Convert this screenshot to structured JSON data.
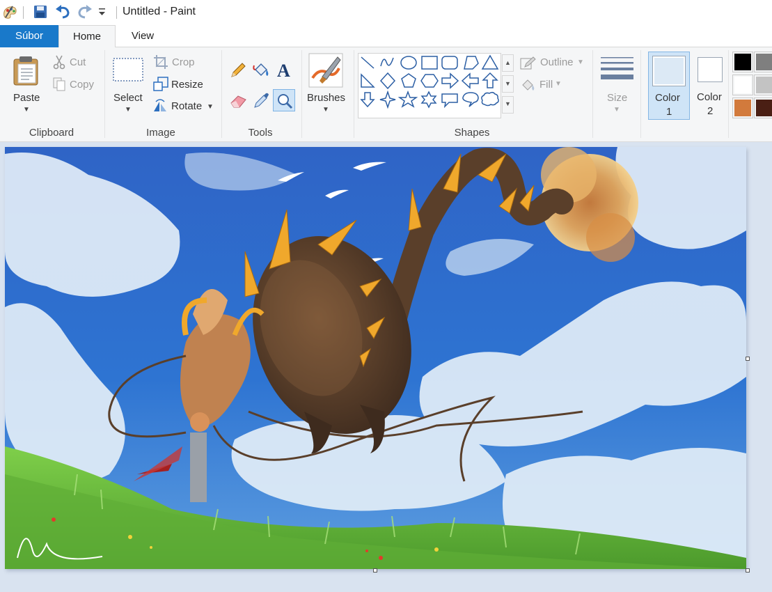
{
  "window": {
    "title": "Untitled - Paint"
  },
  "quick_access": {
    "icons": [
      "paint-app-icon",
      "save-icon",
      "undo-icon",
      "redo-icon",
      "customize-toolbar-icon"
    ]
  },
  "tabs": {
    "file": "Súbor",
    "home": "Home",
    "view": "View"
  },
  "ribbon": {
    "clipboard": {
      "label": "Clipboard",
      "paste": "Paste",
      "cut": "Cut",
      "copy": "Copy"
    },
    "image": {
      "label": "Image",
      "select": "Select",
      "crop": "Crop",
      "resize": "Resize",
      "rotate": "Rotate"
    },
    "tools": {
      "label": "Tools",
      "icons": [
        "pencil-icon",
        "fill-bucket-icon",
        "text-icon",
        "eraser-icon",
        "color-picker-icon",
        "magnifier-icon"
      ]
    },
    "brushes": {
      "label": "Brushes"
    },
    "shapes": {
      "label": "Shapes",
      "outline": "Outline",
      "fill": "Fill",
      "items": [
        "line",
        "curve",
        "oval",
        "rectangle",
        "rounded-rectangle",
        "polygon",
        "triangle",
        "right-triangle",
        "diamond",
        "pentagon",
        "hexagon",
        "right-arrow",
        "left-arrow",
        "up-arrow",
        "down-arrow",
        "four-point-star",
        "five-point-star",
        "six-point-star",
        "rounded-callout",
        "oval-callout",
        "cloud-callout"
      ]
    },
    "size": {
      "label": "Size"
    },
    "color1": {
      "label_line1": "Color",
      "label_line2": "1",
      "color": "#ffffff"
    },
    "color2": {
      "label_line1": "Color",
      "label_line2": "2",
      "color": "#ffffff"
    },
    "palette": [
      "#000000",
      "#7f7f7f",
      "#ffffff",
      "#c3c3c3",
      "#d27a3c",
      "#4a1f14"
    ]
  },
  "canvas": {
    "content": "painting of a dragon flying over grass under a cloudy blue sky"
  },
  "colors": {
    "accent": "#1979ca",
    "ribbon_bg": "#f5f6f7",
    "workspace_bg": "#d9e3f0"
  }
}
